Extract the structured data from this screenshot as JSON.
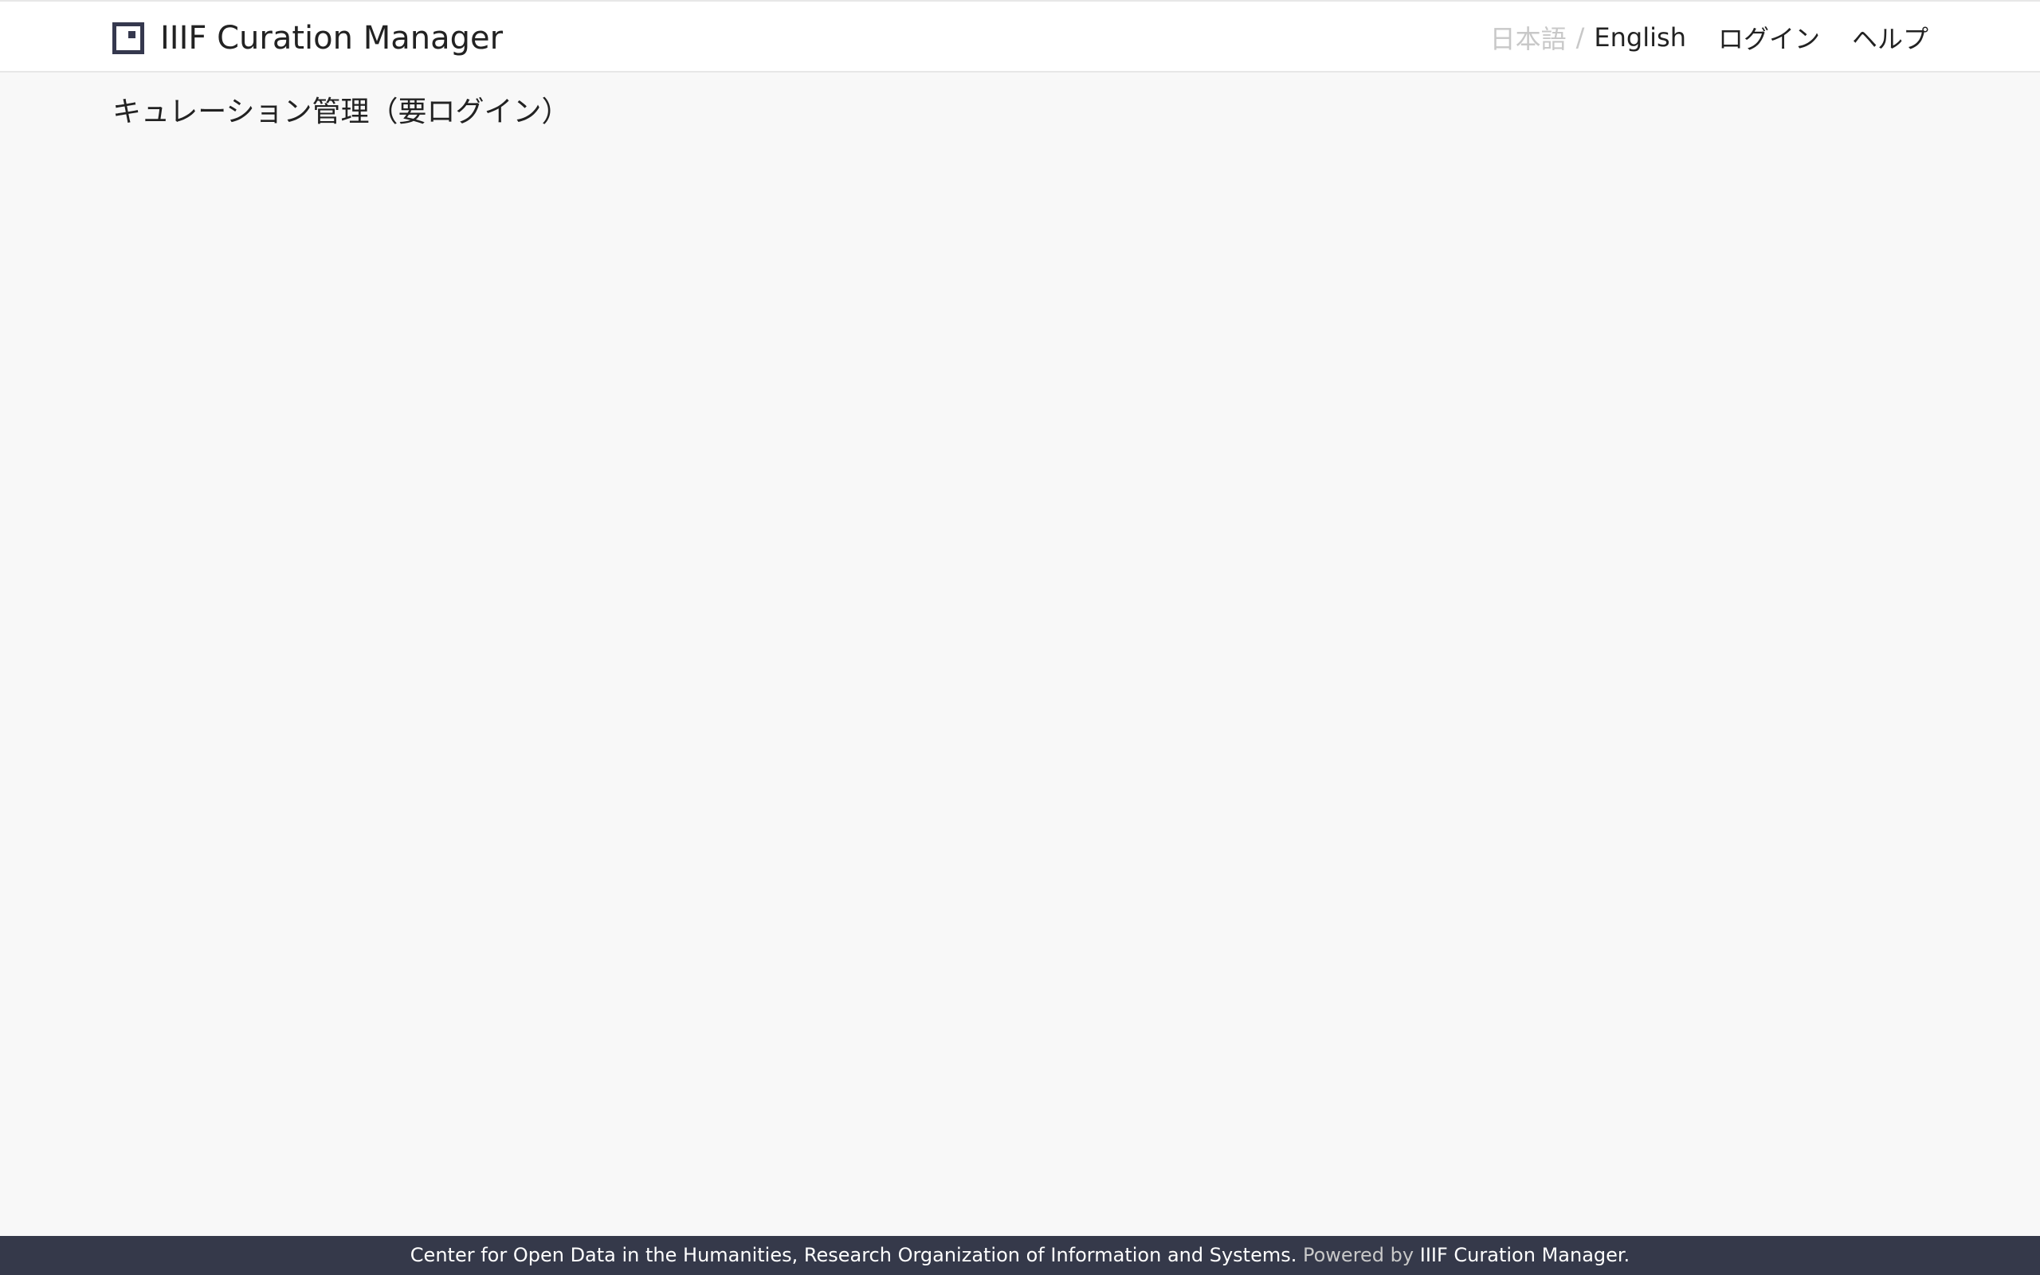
{
  "header": {
    "app_title": "IIIF Curation Manager",
    "logo_icon": "iiif-curation-logo-icon",
    "lang": {
      "ja_label": "日本語",
      "separator": "/",
      "en_label": "English"
    },
    "login_label": "ログイン",
    "help_label": "ヘルプ"
  },
  "main": {
    "title": "キュレーション管理（要ログイン）"
  },
  "footer": {
    "org_text": "Center for Open Data in the Humanities, Research Organization of Information and Systems.",
    "powered_by": "Powered by",
    "product_link": "IIIF Curation Manager."
  },
  "colors": {
    "background": "#f8f8f8",
    "navbar": "#ffffff",
    "footer": "#35394a",
    "logo": "#35384e",
    "muted_text": "#c8c8c8"
  }
}
